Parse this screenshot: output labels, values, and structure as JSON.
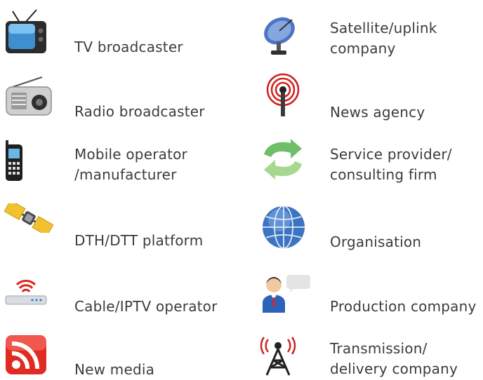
{
  "legend": {
    "left": [
      {
        "label": "TV broadcaster",
        "icon": "tv-icon"
      },
      {
        "label": "Radio broadcaster",
        "icon": "radio-icon"
      },
      {
        "label": "Mobile operator\n/manufacturer",
        "icon": "mobile-phone-icon"
      },
      {
        "label": "DTH/DTT platform",
        "icon": "satellite-icon"
      },
      {
        "label": "Cable/IPTV operator",
        "icon": "wifi-router-icon"
      },
      {
        "label": "New media",
        "icon": "rss-feed-icon"
      }
    ],
    "right": [
      {
        "label": "Satellite/uplink\ncompany",
        "icon": "satellite-dish-icon"
      },
      {
        "label": "News agency",
        "icon": "broadcast-signal-icon"
      },
      {
        "label": "Service provider/\nconsulting firm",
        "icon": "refresh-arrows-icon"
      },
      {
        "label": "Organisation",
        "icon": "globe-icon"
      },
      {
        "label": "Production company",
        "icon": "presenter-icon"
      },
      {
        "label": "Transmission/\ndelivery company",
        "icon": "transmission-tower-icon"
      }
    ]
  }
}
